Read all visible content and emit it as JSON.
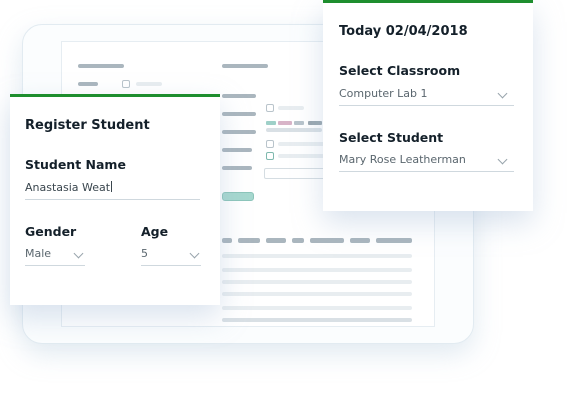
{
  "register_card": {
    "title": "Register Student",
    "student_name_label": "Student Name",
    "student_name_value": "Anastasia Weat",
    "gender_label": "Gender",
    "gender_value": "Male",
    "age_label": "Age",
    "age_value": "5"
  },
  "select_card": {
    "today_label": "Today 02/04/2018",
    "classroom_label": "Select Classroom",
    "classroom_value": "Computer Lab 1",
    "student_label": "Select Student",
    "student_value": "Mary Rose Leatherman"
  },
  "colors": {
    "accent": "#1e8e2e",
    "teal_button": "#a6d8cf"
  },
  "icons": [
    "chevron-down-icon",
    "checkbox-icon"
  ]
}
